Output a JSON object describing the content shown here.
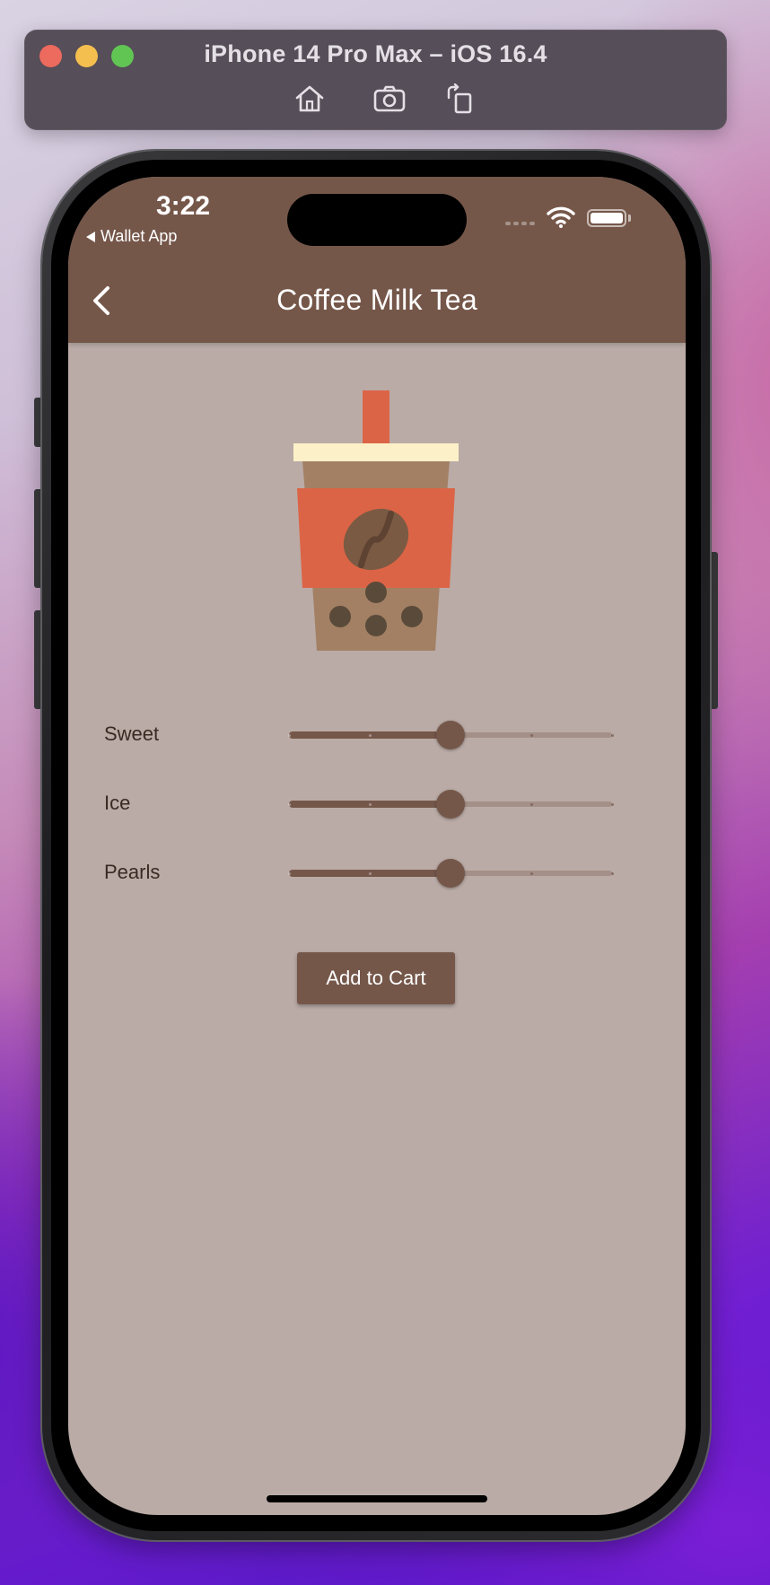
{
  "simulator": {
    "title": "iPhone 14 Pro Max – iOS 16.4",
    "tools": [
      "home-icon",
      "screenshot-icon",
      "rotate-icon"
    ]
  },
  "status_bar": {
    "time": "3:22",
    "back_app": "Wallet App"
  },
  "app_bar": {
    "title": "Coffee Milk Tea",
    "back_icon": "chevron-left-icon"
  },
  "options": [
    {
      "label": "Sweet",
      "value": 0.5,
      "divisions": 4
    },
    {
      "label": "Ice",
      "value": 0.5,
      "divisions": 4
    },
    {
      "label": "Pearls",
      "value": 0.5,
      "divisions": 4
    }
  ],
  "actions": {
    "add_to_cart": "Add to Cart"
  },
  "colors": {
    "primary": "#75574a",
    "background": "#baaba6",
    "cup_band": "#dc6446",
    "cup_body": "#a38064",
    "lid": "#fcf0c8",
    "bean": "#7b5a43",
    "pearls": "#5a4a3a"
  }
}
